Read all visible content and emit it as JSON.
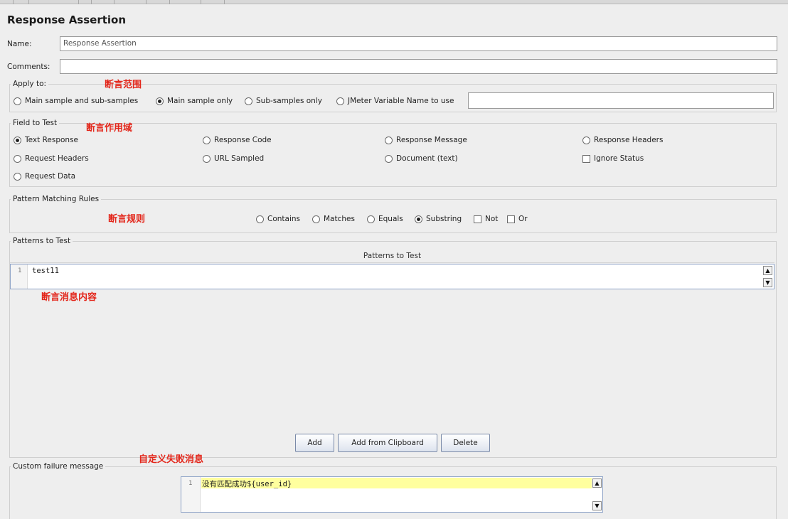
{
  "title": "Response Assertion",
  "name_label": "Name:",
  "name_value": "Response Assertion",
  "comments_label": "Comments:",
  "comments_value": "",
  "annotations": {
    "apply_to": "断言范围",
    "field_to_test": "断言作用域",
    "matching_rules": "断言规则",
    "patterns": "断言消息内容",
    "failure": "自定义失败消息"
  },
  "apply_to": {
    "legend": "Apply to:",
    "options": [
      "Main sample and sub-samples",
      "Main sample only",
      "Sub-samples only",
      "JMeter Variable Name to use"
    ],
    "selected": "Main sample only",
    "variable_value": ""
  },
  "field_to_test": {
    "legend": "Field to Test",
    "options": [
      "Text Response",
      "Response Code",
      "Response Message",
      "Response Headers",
      "Request Headers",
      "URL Sampled",
      "Document (text)",
      "Request Data"
    ],
    "selected": "Text Response",
    "ignore_status_label": "Ignore Status",
    "ignore_status_checked": false
  },
  "matching_rules": {
    "legend": "Pattern Matching Rules",
    "options": [
      "Contains",
      "Matches",
      "Equals",
      "Substring"
    ],
    "selected": "Substring",
    "not_label": "Not",
    "or_label": "Or"
  },
  "patterns": {
    "legend": "Patterns to Test",
    "column_header": "Patterns to Test",
    "lines": [
      {
        "num": "1",
        "text": "test11"
      }
    ]
  },
  "buttons": {
    "add": "Add",
    "add_clipboard": "Add from Clipboard",
    "delete": "Delete"
  },
  "failure": {
    "legend": "Custom failure message",
    "lines": [
      {
        "num": "1",
        "text": "没有匹配成功${user_id}"
      }
    ]
  }
}
